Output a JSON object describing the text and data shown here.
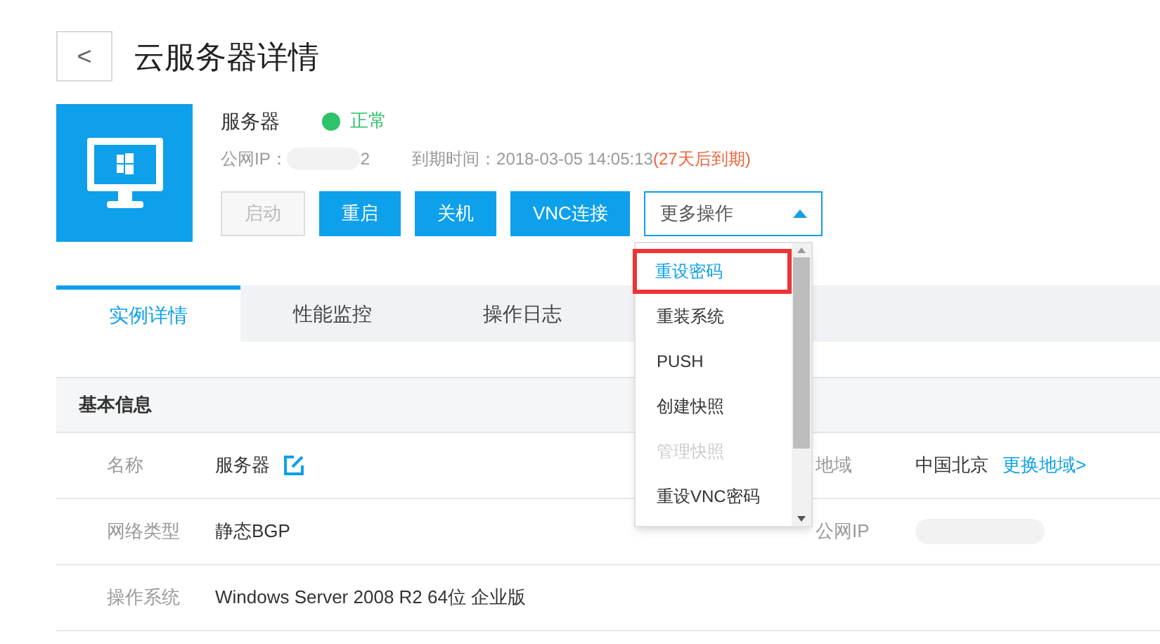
{
  "header": {
    "back": "<",
    "title": "云服务器详情"
  },
  "server": {
    "name": "服务器",
    "status": {
      "label": "正常",
      "color": "#2ec26a"
    },
    "ip_label": "公网IP：",
    "ip_tail": "2",
    "expiry_label": "到期时间：",
    "expiry": "2018-03-05 14:05:13",
    "expiry_note": "(27天后到期)"
  },
  "actions": [
    {
      "label": "启动",
      "disabled": true
    },
    {
      "label": "重启",
      "disabled": false
    },
    {
      "label": "关机",
      "disabled": false
    },
    {
      "label": "VNC连接",
      "disabled": false
    }
  ],
  "more": {
    "label": "更多操作",
    "expanded": true,
    "items": [
      {
        "label": "重设密码",
        "highlighted": true,
        "disabled": false
      },
      {
        "label": "重装系统",
        "highlighted": false,
        "disabled": false
      },
      {
        "label": "PUSH",
        "highlighted": false,
        "disabled": false
      },
      {
        "label": "创建快照",
        "highlighted": false,
        "disabled": false
      },
      {
        "label": "管理快照",
        "highlighted": false,
        "disabled": true
      },
      {
        "label": "重设VNC密码",
        "highlighted": false,
        "disabled": false
      }
    ]
  },
  "tabs": [
    {
      "label": "实例详情",
      "selected": true
    },
    {
      "label": "性能监控",
      "selected": false
    },
    {
      "label": "操作日志",
      "selected": false
    }
  ],
  "section": {
    "title": "基本信息"
  },
  "rows": [
    {
      "label": "名称",
      "value": "服务器",
      "editable": true,
      "right_label": "地域",
      "right_value": "中国北京",
      "right_link": "更换地域>"
    },
    {
      "label": "网络类型",
      "value": "静态BGP",
      "editable": false,
      "right_label": "公网IP",
      "right_blurred": true
    },
    {
      "label": "操作系统",
      "value": "Windows Server 2008 R2 64位 企业版",
      "editable": false
    }
  ]
}
